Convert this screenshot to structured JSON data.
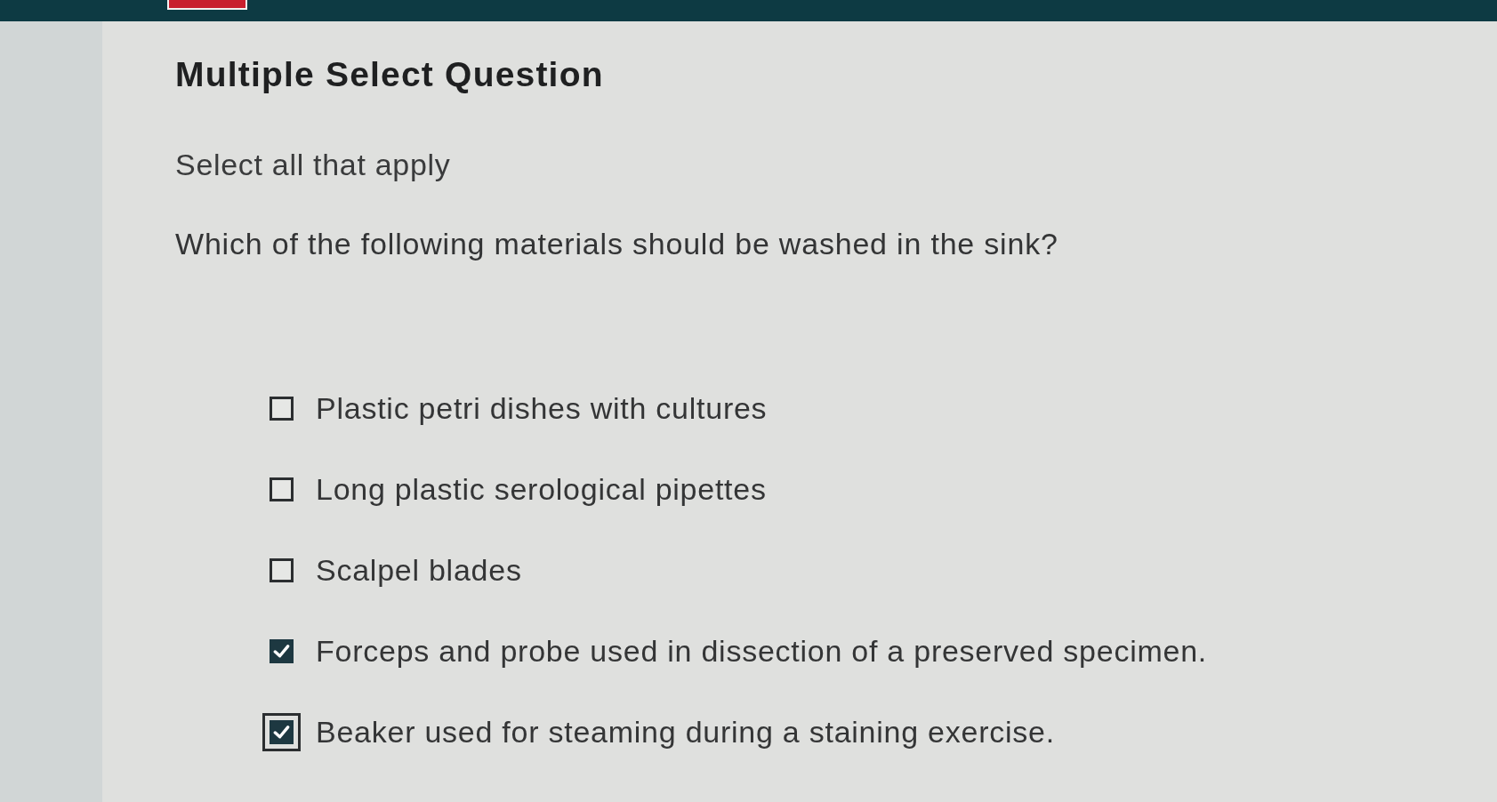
{
  "question": {
    "type": "Multiple Select Question",
    "instruction": "Select all that apply",
    "prompt": "Which of the following materials should be washed in the sink?"
  },
  "options": [
    {
      "label": "Plastic petri dishes with cultures",
      "checked": false,
      "focused": false
    },
    {
      "label": "Long plastic serological pipettes",
      "checked": false,
      "focused": false
    },
    {
      "label": "Scalpel blades",
      "checked": false,
      "focused": false
    },
    {
      "label": "Forceps and probe used in dissection of a preserved specimen.",
      "checked": true,
      "focused": false
    },
    {
      "label": "Beaker used for steaming during a staining exercise.",
      "checked": true,
      "focused": true
    }
  ]
}
